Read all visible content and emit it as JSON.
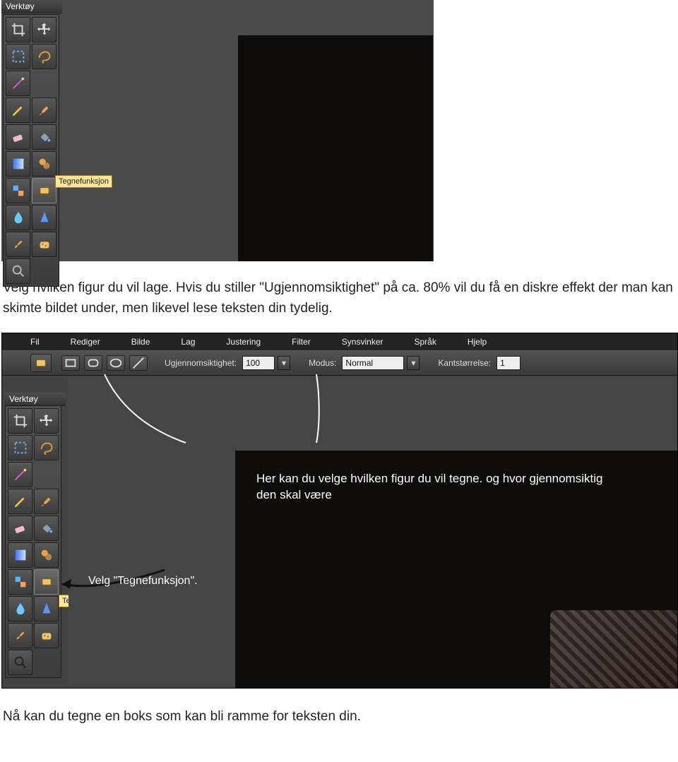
{
  "tool_panel_title": "Verktøy",
  "tooltip_text": "Tegnefunksjon",
  "paragraph": "Velg hvilken figur du vil lage. Hvis du stiller \"Ugjennomsiktighet\" på ca. 80% vil du få en diskre effekt der man kan skimte bildet under, men likevel lese teksten din tydelig.",
  "outro": "Nå kan du tegne en boks som kan bli ramme for teksten din.",
  "menu": {
    "items": [
      "Fil",
      "Rediger",
      "Bilde",
      "Lag",
      "Justering",
      "Filter",
      "Synsvinker",
      "Språk",
      "Hjelp"
    ]
  },
  "options": {
    "opacity_label": "Ugjennomsiktighet:",
    "opacity_value": "100",
    "mode_label": "Modus:",
    "mode_value": "Normal",
    "edge_label": "Kantstørrelse:",
    "edge_value": "1"
  },
  "anno": {
    "main": "Her kan du velge hvilken figur du vil tegne. og hvor gjennomsiktig den skal være",
    "velg": "Velg \"Tegnefunksjon\"."
  },
  "tool_names": [
    [
      "crop",
      "move"
    ],
    [
      "marquee",
      "lasso"
    ],
    [
      "wand",
      "spacer"
    ],
    [
      "pencil",
      "brush"
    ],
    [
      "eraser",
      "bucket"
    ],
    [
      "gradient",
      "clone"
    ],
    [
      "colorreplace",
      "shape"
    ],
    [
      "blur",
      "sharpen"
    ],
    [
      "smudge",
      "sponge"
    ],
    [
      "dodge",
      "burn"
    ],
    [
      "redeye",
      "spot"
    ],
    [
      "bloat",
      "pinch"
    ]
  ]
}
